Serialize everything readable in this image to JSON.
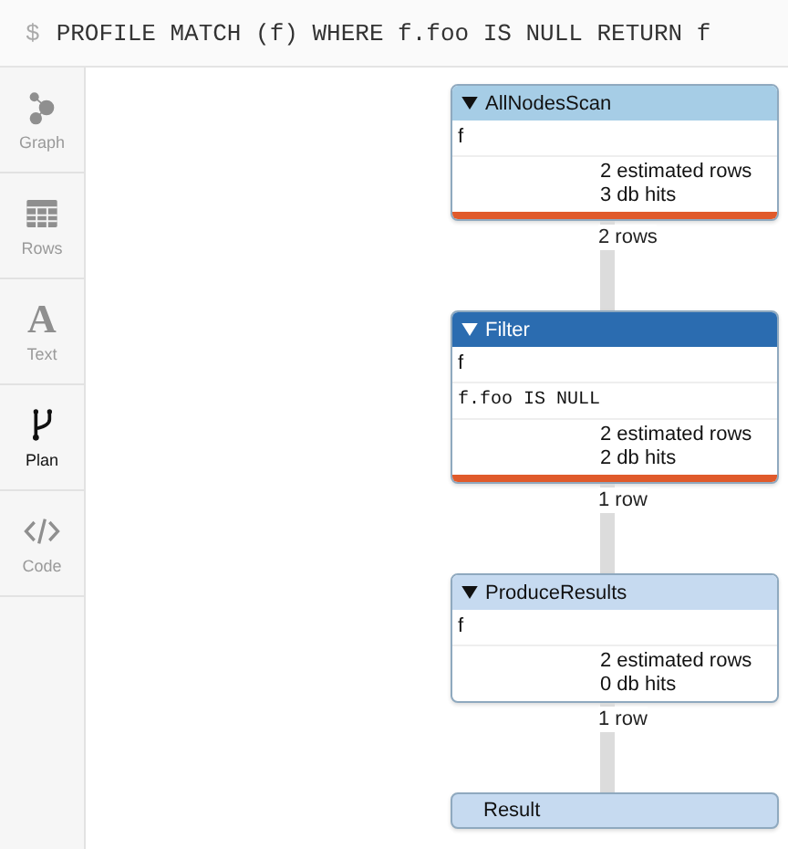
{
  "query": {
    "prompt": "$",
    "text": "PROFILE MATCH (f) WHERE f.foo IS NULL RETURN f"
  },
  "sidebar": {
    "items": [
      {
        "label": "Graph",
        "kind": "graph",
        "selected": false
      },
      {
        "label": "Rows",
        "kind": "rows",
        "selected": false
      },
      {
        "label": "Text",
        "kind": "text",
        "glyph": "A",
        "selected": false
      },
      {
        "label": "Plan",
        "kind": "plan",
        "selected": true
      },
      {
        "label": "Code",
        "kind": "code",
        "selected": false
      }
    ]
  },
  "plan": {
    "operators": [
      {
        "kind": "operator",
        "title": "AllNodesScan",
        "color": "#a6cde6",
        "details": [
          {
            "kind": "identifier",
            "text": "f"
          }
        ],
        "estimated_rows": "2 estimated rows",
        "db_hits": "3 db hits",
        "hot": true,
        "rows_out": "2 rows"
      },
      {
        "kind": "operator",
        "title": "Filter",
        "color": "#2b6cb0",
        "details": [
          {
            "kind": "identifier",
            "text": "f"
          },
          {
            "kind": "expression",
            "text": "f.foo IS NULL"
          }
        ],
        "estimated_rows": "2 estimated rows",
        "db_hits": "2 db hits",
        "hot": true,
        "rows_out": "1 row"
      },
      {
        "kind": "operator",
        "title": "ProduceResults",
        "color": "#c6daf0",
        "details": [
          {
            "kind": "identifier",
            "text": "f"
          }
        ],
        "estimated_rows": "2 estimated rows",
        "db_hits": "0 db hits",
        "hot": false,
        "rows_out": "1 row"
      },
      {
        "kind": "result",
        "title": "Result",
        "color": "#c6daf0"
      }
    ]
  }
}
